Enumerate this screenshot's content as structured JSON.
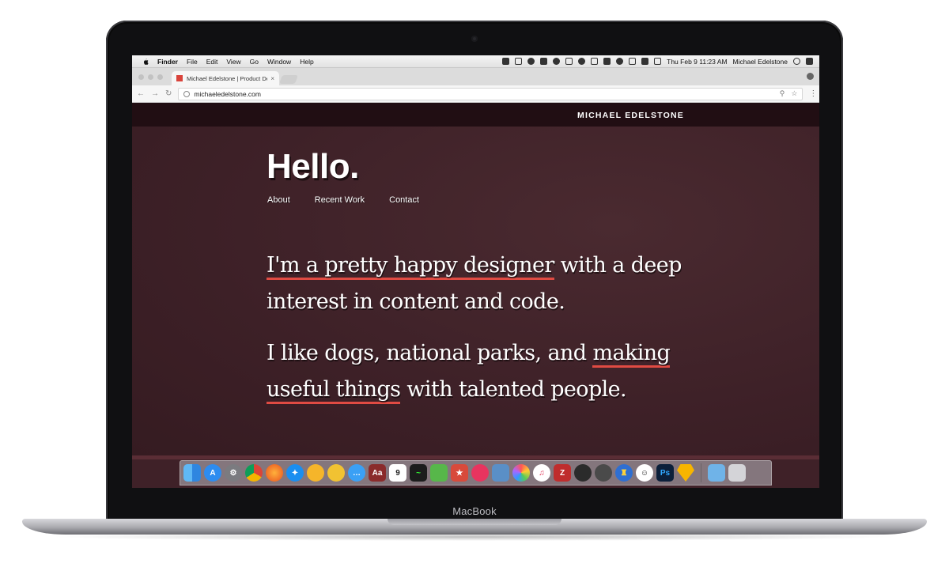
{
  "menubar": {
    "app": "Finder",
    "menus": [
      "File",
      "Edit",
      "View",
      "Go",
      "Window",
      "Help"
    ],
    "clock": "Thu Feb 9  11:23 AM",
    "user": "Michael Edelstone"
  },
  "browser": {
    "tab_title": "Michael Edelstone | Product De",
    "tab_close": "×",
    "url": "michaeledelstone.com"
  },
  "site": {
    "name": "MICHAEL EDELSTONE",
    "heading": "Hello.",
    "nav": [
      "About",
      "Recent Work",
      "Contact"
    ],
    "p1": {
      "highlight": "I'm a pretty happy designer",
      "rest": " with a deep interest in content and code."
    },
    "p2": {
      "before": "I like dogs, national parks, and ",
      "highlight": "making useful things",
      "after": " with talented people."
    },
    "highlight_color": "#e04b43",
    "background_color": "#3f2128"
  },
  "dock": {
    "icons": [
      "finder-icon",
      "app-store-icon",
      "system-preferences-icon",
      "chrome-icon",
      "firefox-icon",
      "safari-icon",
      "chrome-canary-icon",
      "chrome-canary-yellow-icon",
      "messages-icon",
      "dictionary-icon",
      "calendar-icon",
      "activity-monitor-icon",
      "evernote-icon",
      "wunderlist-icon",
      "lips-app-icon",
      "preview-icon",
      "photos-icon",
      "itunes-icon",
      "filezilla-icon",
      "github-icon",
      "monodraw-icon",
      "tower-icon",
      "smile-icon",
      "photoshop-icon",
      "sketch-icon",
      "downloads-folder-icon",
      "trash-icon"
    ],
    "calendar_day": "9",
    "dictionary_label": "Aa",
    "photoshop_label": "Ps",
    "filezilla_label": "Z"
  },
  "device": {
    "brand": "MacBook"
  }
}
